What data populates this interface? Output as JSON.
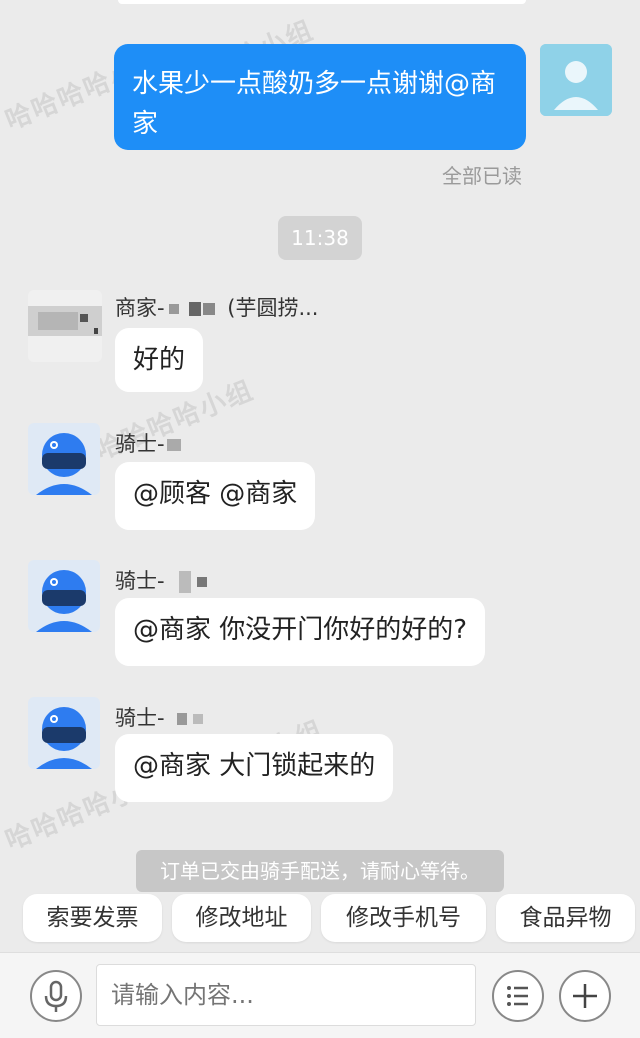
{
  "messages": {
    "self_message": "水果少一点酸奶多一点谢谢@商家",
    "self_message_line1": "水果少一点酸奶多一点谢谢@商",
    "self_message_line2": "家",
    "read_status": "全部已读",
    "time": "11:38",
    "merchant_sender": "商家-",
    "merchant_sender_suffix": "(芋圆捞...",
    "merchant_reply": "好的",
    "rider_sender": "骑士-",
    "rider_msg_1": "@顾客 @商家",
    "rider_msg_2": "@商家 你没开门你好的好的?",
    "rider_msg_3": "@商家 大门锁起来的"
  },
  "toast": "订单已交由骑手配送，请耐心等待。",
  "quick_actions": [
    "索要发票",
    "修改地址",
    "修改手机号",
    "食品异物"
  ],
  "input": {
    "placeholder": "请输入内容..."
  },
  "icons": {
    "voice": "microphone-icon",
    "menu": "list-menu-icon",
    "add": "plus-icon"
  },
  "watermark": "哈哈哈哈小组",
  "colors": {
    "self_bubble": "#1e8ef7",
    "background": "#ebebeb",
    "rider_avatar": "#2e7cf0"
  }
}
